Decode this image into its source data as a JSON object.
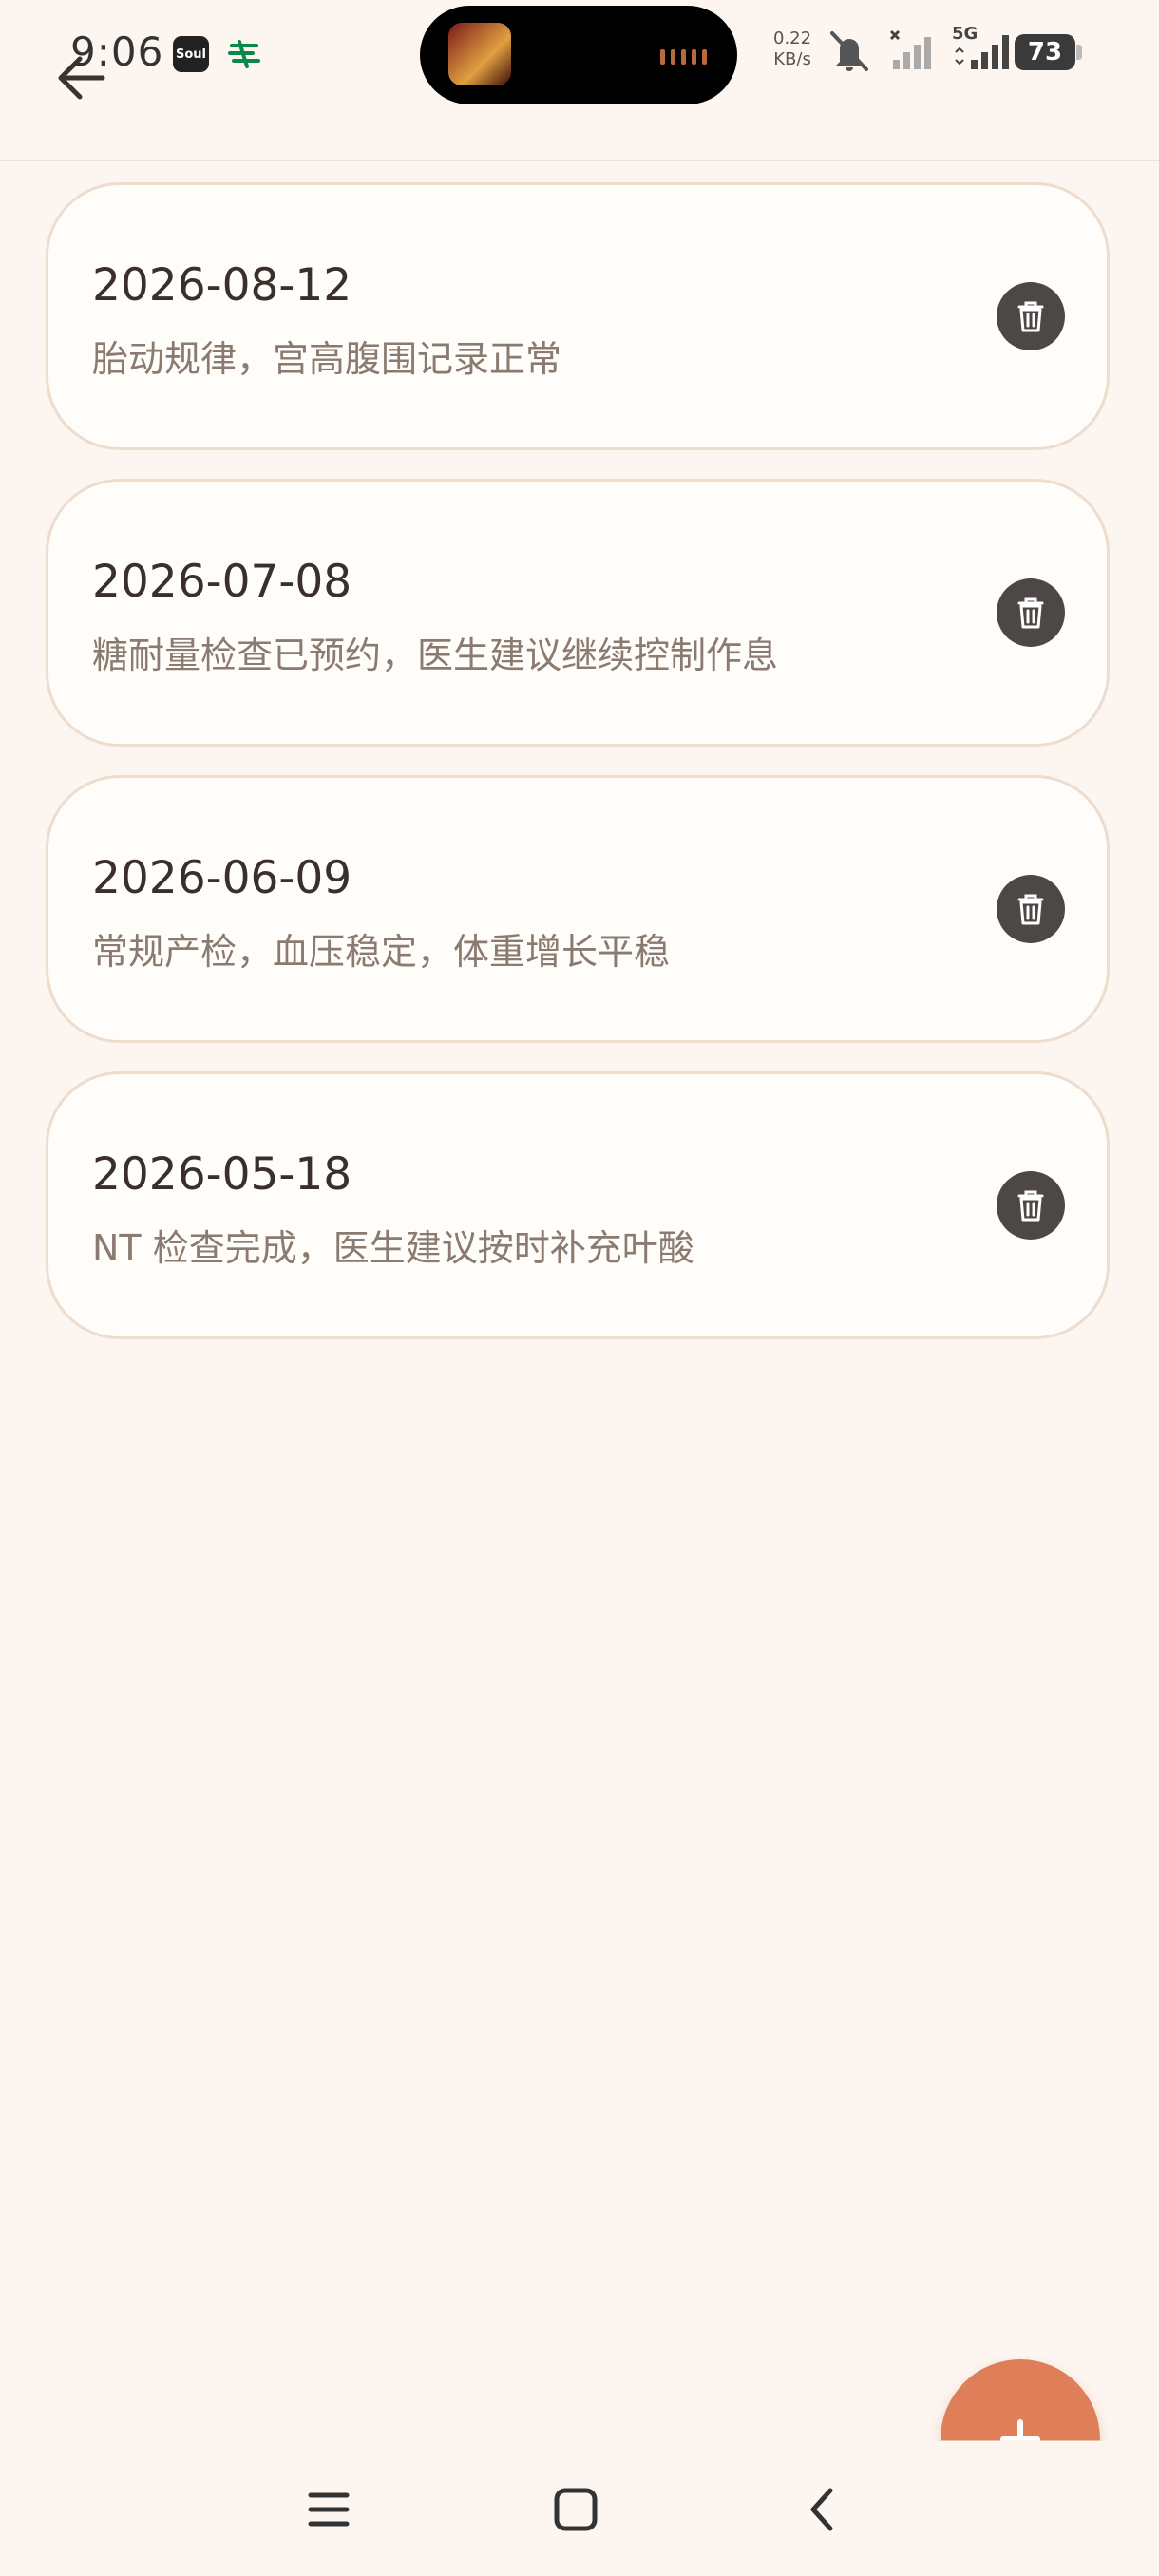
{
  "status_bar": {
    "time": "9:06",
    "soul_app_label": "Soul",
    "net_speed_value": "0.22",
    "net_speed_unit": "KB/s",
    "network_type": "5G",
    "battery_level": "73"
  },
  "records": [
    {
      "date": "2026-08-12",
      "note": "胎动规律，宫高腹围记录正常"
    },
    {
      "date": "2026-07-08",
      "note": "糖耐量检查已预约，医生建议继续控制作息"
    },
    {
      "date": "2026-06-09",
      "note": "常规产检，血压稳定，体重增长平稳"
    },
    {
      "date": "2026-05-18",
      "note": "NT 检查完成，医生建议按时补充叶酸"
    }
  ],
  "colors": {
    "background": "#fdf6f0",
    "card_background": "#fffdf9",
    "card_border": "#eedccd",
    "accent": "#de7f5a",
    "delete_button": "#4d4845"
  },
  "icons": {
    "back": "arrow-left-icon",
    "delete": "trash-icon",
    "add": "plus-icon",
    "nav_menu": "menu-icon",
    "nav_home": "home-icon",
    "nav_back": "chevron-left-icon"
  }
}
